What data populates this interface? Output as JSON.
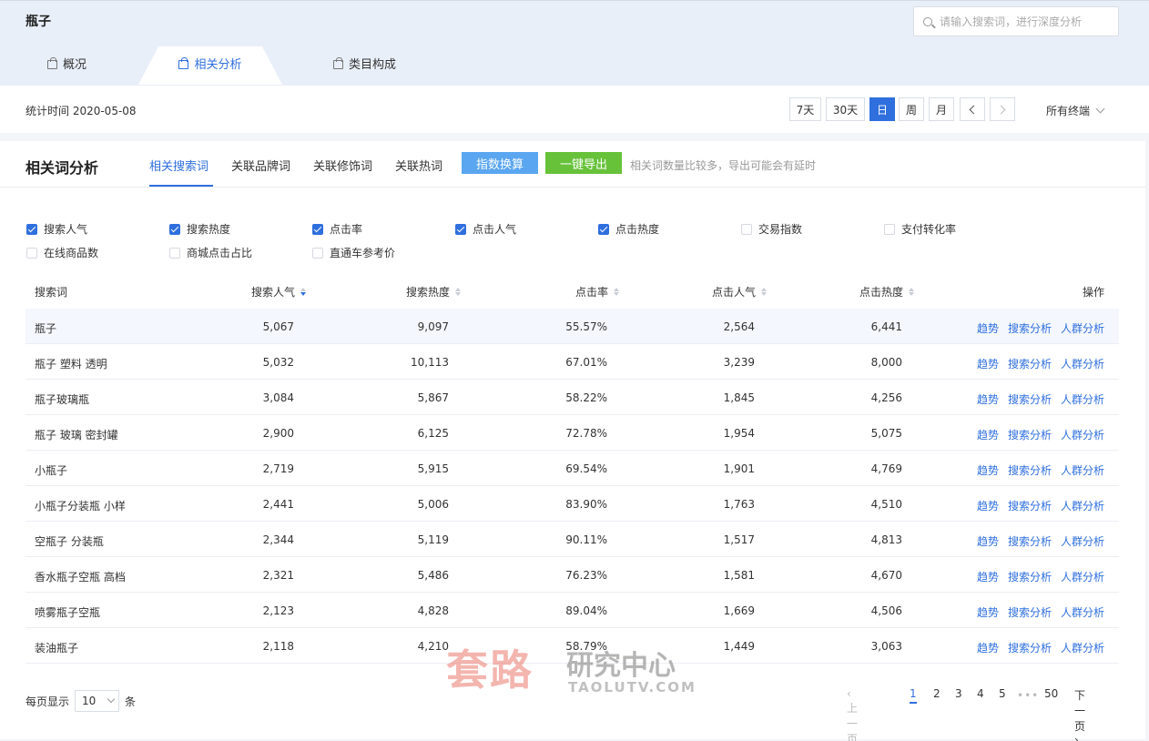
{
  "header": {
    "title": "瓶子",
    "search_placeholder": "请输入搜索词，进行深度分析",
    "tabs": [
      {
        "label": "概况",
        "active": false
      },
      {
        "label": "相关分析",
        "active": true
      },
      {
        "label": "类目构成",
        "active": false
      }
    ]
  },
  "datebar": {
    "stat_time": "统计时间 2020-05-08",
    "ranges": [
      "7天",
      "30天",
      "日",
      "周",
      "月"
    ],
    "active_range": "日",
    "terminal": "所有终端"
  },
  "panel": {
    "title": "相关词分析",
    "subtabs": [
      "相关搜索词",
      "关联品牌词",
      "关联修饰词",
      "关联热词"
    ],
    "active_subtab": "相关搜索词",
    "index_button": "指数换算",
    "export_button": "一键导出",
    "hint": "相关词数量比较多，导出可能会有延时"
  },
  "metrics": [
    {
      "label": "搜索人气",
      "checked": true
    },
    {
      "label": "搜索热度",
      "checked": true
    },
    {
      "label": "点击率",
      "checked": true
    },
    {
      "label": "点击人气",
      "checked": true
    },
    {
      "label": "点击热度",
      "checked": true
    },
    {
      "label": "交易指数",
      "checked": false
    },
    {
      "label": "支付转化率",
      "checked": false
    },
    {
      "label": "在线商品数",
      "checked": false
    },
    {
      "label": "商城点击占比",
      "checked": false
    },
    {
      "label": "直通车参考价",
      "checked": false
    }
  ],
  "table": {
    "columns": [
      "搜索词",
      "搜索人气",
      "搜索热度",
      "点击率",
      "点击人气",
      "点击热度",
      "操作"
    ],
    "sorted_column": "搜索人气",
    "sort_direction": "desc",
    "actions": [
      "趋势",
      "搜索分析",
      "人群分析"
    ],
    "rows": [
      [
        "瓶子",
        "5,067",
        "9,097",
        "55.57%",
        "2,564",
        "6,441"
      ],
      [
        "瓶子 塑料 透明",
        "5,032",
        "10,113",
        "67.01%",
        "3,239",
        "8,000"
      ],
      [
        "瓶子玻璃瓶",
        "3,084",
        "5,867",
        "58.22%",
        "1,845",
        "4,256"
      ],
      [
        "瓶子 玻璃 密封罐",
        "2,900",
        "6,125",
        "72.78%",
        "1,954",
        "5,075"
      ],
      [
        "小瓶子",
        "2,719",
        "5,915",
        "69.54%",
        "1,901",
        "4,769"
      ],
      [
        "小瓶子分装瓶 小样",
        "2,441",
        "5,006",
        "83.90%",
        "1,763",
        "4,510"
      ],
      [
        "空瓶子 分装瓶",
        "2,344",
        "5,119",
        "90.11%",
        "1,517",
        "4,813"
      ],
      [
        "香水瓶子空瓶 高档",
        "2,321",
        "5,486",
        "76.23%",
        "1,581",
        "4,670"
      ],
      [
        "喷雾瓶子空瓶",
        "2,123",
        "4,828",
        "89.04%",
        "1,669",
        "4,506"
      ],
      [
        "装油瓶子",
        "2,118",
        "4,210",
        "58.79%",
        "1,449",
        "3,063"
      ]
    ]
  },
  "pagination": {
    "per_page_label": "每页显示",
    "per_page_value": "10",
    "per_page_unit": "条",
    "prev": "上一页",
    "next": "下一页",
    "pages": [
      "1",
      "2",
      "3",
      "4",
      "5"
    ],
    "ellipsis": "•••",
    "last_page": "50",
    "current_page": "1"
  },
  "watermark": {
    "main": "套路",
    "sub": "研究中心",
    "url": "TAOLUTV.COM"
  }
}
